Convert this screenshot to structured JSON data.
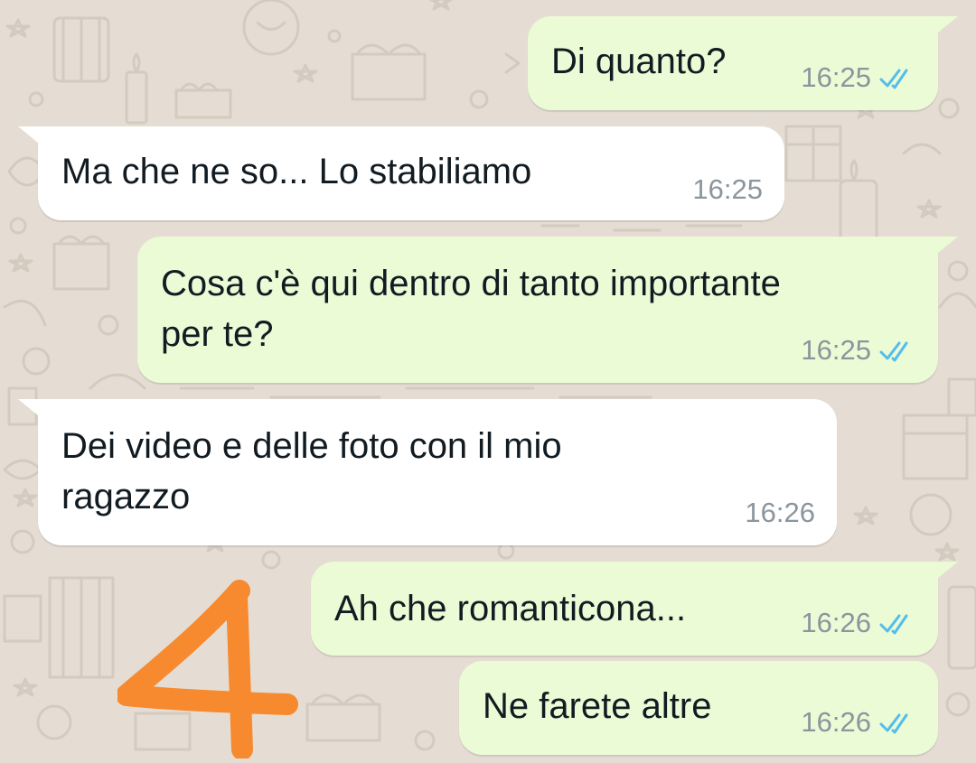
{
  "chat": {
    "messages": [
      {
        "direction": "sent",
        "lines": [
          "Di quanto?"
        ],
        "time": "16:25",
        "status": "read",
        "status_icon": "double-check-icon"
      },
      {
        "direction": "received",
        "lines": [
          "Ma che ne so... Lo stabiliamo"
        ],
        "time": "16:25"
      },
      {
        "direction": "sent",
        "lines": [
          "Cosa c'è qui dentro di tanto importante",
          "per te?"
        ],
        "time": "16:25",
        "status": "read",
        "status_icon": "double-check-icon"
      },
      {
        "direction": "received",
        "lines": [
          "Dei video e delle foto con il mio",
          "ragazzo"
        ],
        "time": "16:26"
      },
      {
        "direction": "sent",
        "lines": [
          "Ah che romanticona..."
        ],
        "time": "16:26",
        "status": "read",
        "status_icon": "double-check-icon"
      },
      {
        "direction": "sent",
        "lines": [
          "Ne farete altre"
        ],
        "time": "16:26",
        "status": "read",
        "status_icon": "double-check-icon"
      }
    ]
  },
  "annotation": {
    "text": "4",
    "color": "#f7892e"
  },
  "colors": {
    "background": "#e5ddd3",
    "sent_bubble": "#ebfbd6",
    "received_bubble": "#ffffff",
    "read_ticks": "#53bdeb",
    "timestamp": "#8a959d",
    "message_text": "#111b21"
  }
}
